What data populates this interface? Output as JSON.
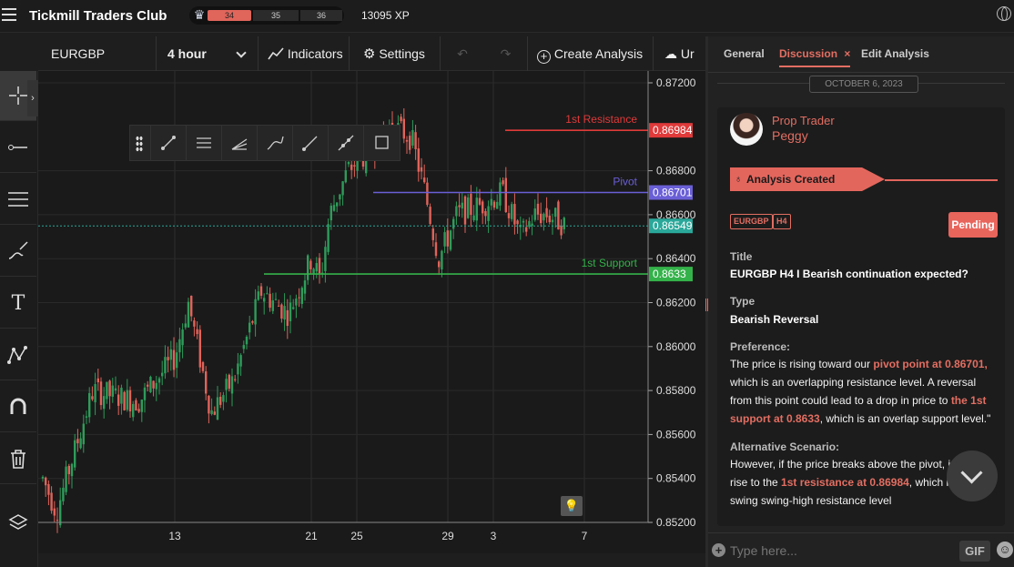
{
  "app": {
    "title": "Tickmill Traders Club"
  },
  "xp": {
    "level_current": "34",
    "level_next": "35",
    "level_after": "36",
    "points": "13095 XP"
  },
  "toolbar": {
    "symbol": "EURGBP",
    "timeframe": "4 hour",
    "indicators_label": "Indicators",
    "settings_label": "Settings",
    "create_analysis_label": "Create Analysis",
    "upload_label": "Ur"
  },
  "chart": {
    "price_ticks": [
      "0.87200",
      "0.86800",
      "0.86600",
      "0.86400",
      "0.86200",
      "0.86000",
      "0.85800",
      "0.85600",
      "0.85400",
      "0.85200"
    ],
    "x_ticks": [
      "13",
      "21",
      "25",
      "29",
      "3",
      "7"
    ],
    "lines": {
      "resistance": {
        "label": "1st Resistance",
        "value": "0.86984",
        "color": "#e03a3a"
      },
      "pivot": {
        "label": "Pivot",
        "value": "0.86701",
        "color": "#6a5fd6"
      },
      "current": {
        "value": "0.86549",
        "color": "#2aa89a"
      },
      "support": {
        "label": "1st Support",
        "value": "0.8633",
        "color": "#34b24a"
      }
    },
    "y_range": [
      0.852,
      0.872
    ]
  },
  "panel": {
    "tabs": [
      "General",
      "Discussion",
      "Edit Analysis"
    ],
    "date": "OCTOBER 6, 2023",
    "user_role": "Prop Trader",
    "user_name": "Peggy",
    "banner": "Analysis Created",
    "tag_symbol": "EURGBP",
    "tag_tf": "H4",
    "status": "Pending",
    "title_label": "Title",
    "title_value": "EURGBP H4 I Bearish continuation expected?",
    "type_label": "Type",
    "type_value": "Bearish Reversal",
    "pref_label": "Preference:",
    "pref_l1a": " The price is rising toward our ",
    "pref_l1b": "pivot point at 0.86701,",
    "pref_l2": "which is an overlapping resistance level. A reversal",
    "pref_l3a": "from this point could lead to a drop in price to ",
    "pref_l3b": "the 1st",
    "pref_l4a": "support at 0.8633",
    "pref_l4b": ", which is an overlap support level.\"",
    "alt_label": "Alternative Scenario:",
    "alt_l1": "However, if the price breaks above the pivot, i",
    "alt_l2a": "rise to the ",
    "alt_l2b": "1st resistance at 0.86984",
    "alt_l2c": ", which i",
    "alt_l3": "swing swing-high resistance level",
    "composer_placeholder": "Type here...",
    "gif_label": "GIF"
  }
}
